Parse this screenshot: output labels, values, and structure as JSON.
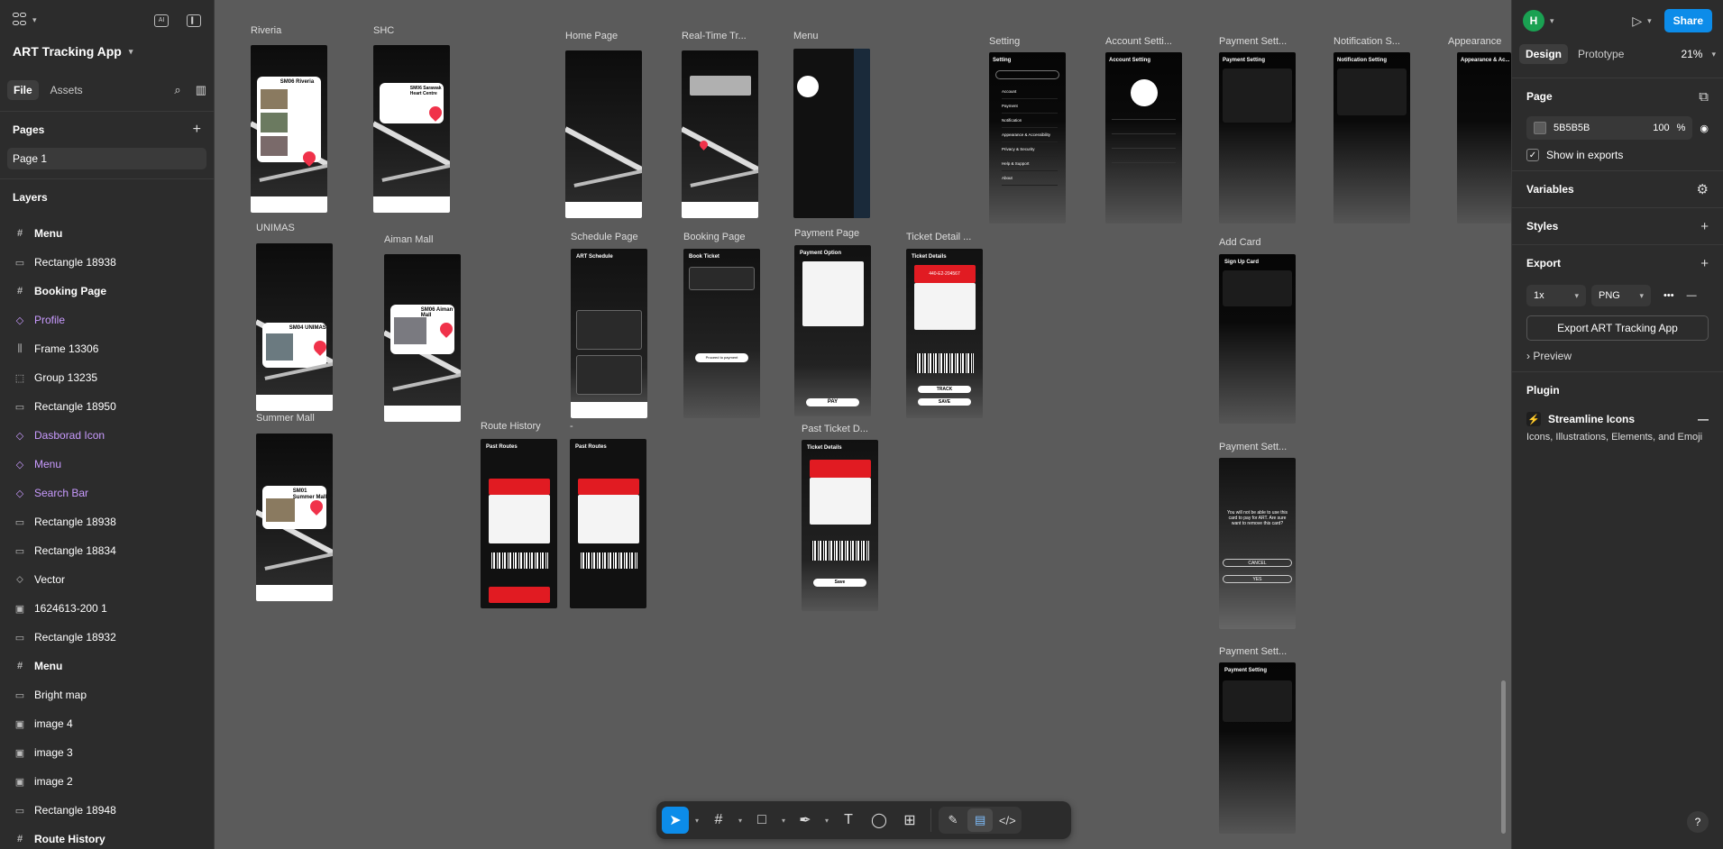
{
  "file": {
    "name": "ART Tracking App"
  },
  "left_tabs": {
    "file": "File",
    "assets": "Assets"
  },
  "pages": {
    "title": "Pages",
    "items": [
      "Page 1"
    ]
  },
  "layers": {
    "title": "Layers",
    "items": [
      {
        "name": "Menu",
        "kind": "frame"
      },
      {
        "name": "Rectangle 18938",
        "kind": "rect"
      },
      {
        "name": "Booking Page",
        "kind": "frame"
      },
      {
        "name": "Profile",
        "kind": "component"
      },
      {
        "name": "Frame 13306",
        "kind": "autolayout"
      },
      {
        "name": "Group 13235",
        "kind": "group"
      },
      {
        "name": "Rectangle 18950",
        "kind": "rect"
      },
      {
        "name": "Dasborad Icon",
        "kind": "component"
      },
      {
        "name": "Menu",
        "kind": "component"
      },
      {
        "name": "Search Bar",
        "kind": "component"
      },
      {
        "name": "Rectangle 18938",
        "kind": "rect"
      },
      {
        "name": "Rectangle 18834",
        "kind": "rect"
      },
      {
        "name": "Vector",
        "kind": "vector"
      },
      {
        "name": "1624613-200 1",
        "kind": "image"
      },
      {
        "name": "Rectangle 18932",
        "kind": "rect"
      },
      {
        "name": "Menu",
        "kind": "frame"
      },
      {
        "name": "Bright map",
        "kind": "rect"
      },
      {
        "name": "image 4",
        "kind": "image"
      },
      {
        "name": "image 3",
        "kind": "image"
      },
      {
        "name": "image 2",
        "kind": "image"
      },
      {
        "name": "Rectangle 18948",
        "kind": "rect"
      },
      {
        "name": "Route History",
        "kind": "frame"
      }
    ]
  },
  "canvas_frames": {
    "riveria": "Riveria",
    "shc": "SHC",
    "home": "Home Page",
    "realtime": "Real-Time Tr...",
    "menu": "Menu",
    "setting": "Setting",
    "account": "Account Setti...",
    "payset1": "Payment Sett...",
    "notif": "Notification S...",
    "appear": "Appearance",
    "unimas": "UNIMAS",
    "aiman": "Aiman Mall",
    "schedule": "Schedule Page",
    "booking": "Booking Page",
    "payment": "Payment Page",
    "ticket": "Ticket Detail ...",
    "addcard": "Add Card",
    "summer": "Summer Mall",
    "route": "Route History",
    "dash": "-",
    "pastticket": "Past Ticket D...",
    "payset2": "Payment Sett...",
    "payset3": "Payment Sett..."
  },
  "screen_text": {
    "riveria_title": "SM06 Riveria",
    "shc_title": "SM06 Sarawak Heart Centre",
    "unimas_title": "SM04 UNIMAS",
    "aiman_title": "SM06 Aiman Mall",
    "summer_title": "SM01 Summer Mall",
    "setting_head": "Setting",
    "account_head": "Account Setting",
    "payment_head": "Payment Setting",
    "notif_head": "Notification Setting",
    "appear_head": "Appearance & Ac...",
    "schedule_head": "ART Schedule",
    "booking_head": "Book Ticket",
    "payopt_head": "Payment Option",
    "ticket_head": "Ticket Details",
    "signup_head": "Sign Up Card",
    "past_head": "Past Routes",
    "ticket_no": "440-E2-204567",
    "pay_btn": "PAY",
    "track_btn": "TRACK",
    "save_btn": "SAVE",
    "save_btn2": "Save",
    "proceed_btn": "Proceed to payment",
    "remove_msg": "You will not be able to use this card to pay for ART. Are sure want to remove this card?",
    "cancel_btn": "CANCEL",
    "yes_btn": "YES",
    "setting_items": [
      "Account",
      "Payment",
      "Notification",
      "Appearance & Accessibility",
      "Privacy & Security",
      "Help & Support",
      "About"
    ]
  },
  "toolbar": {
    "tools": [
      "move",
      "frame",
      "shape",
      "pen",
      "text",
      "comment",
      "actions"
    ]
  },
  "right_panel": {
    "avatar_letter": "H",
    "share": "Share",
    "tabs": {
      "design": "Design",
      "prototype": "Prototype"
    },
    "zoom": "21%",
    "page_section": "Page",
    "fill_hex": "5B5B5B",
    "fill_opacity": "100",
    "fill_unit": "%",
    "show_in_exports": "Show in exports",
    "variables": "Variables",
    "styles": "Styles",
    "export": "Export",
    "export_scale": "1x",
    "export_format": "PNG",
    "export_button": "Export ART Tracking App",
    "preview": "Preview",
    "plugin": "Plugin",
    "plugin_name": "Streamline Icons",
    "plugin_desc": "Icons, Illustrations, Elements, and Emoji"
  },
  "colors": {
    "accent": "#0c8ce9",
    "canvas": "#5b5b5b",
    "panel": "#2c2c2c",
    "ticket_red": "#e11b22",
    "pin": "#f0324a",
    "component": "#c99bff"
  }
}
